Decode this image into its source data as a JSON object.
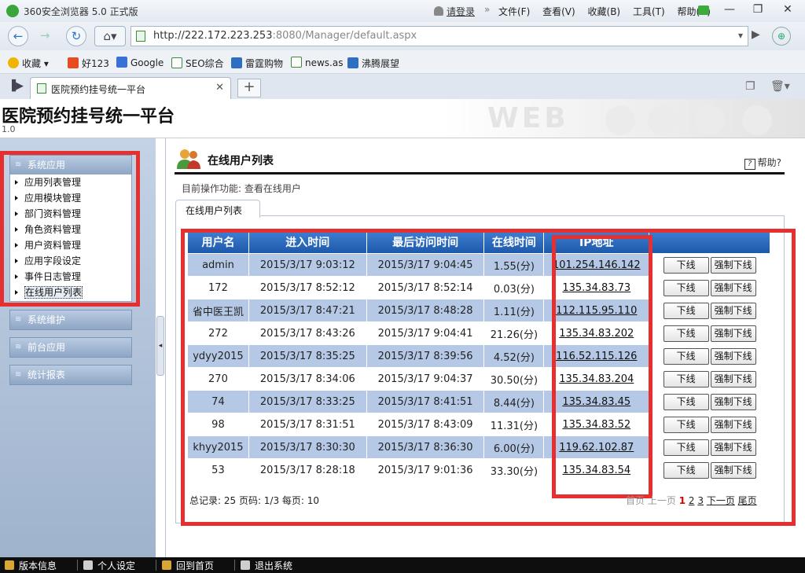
{
  "browser": {
    "title": "360安全浏览器 5.0 正式版",
    "login": "请登录",
    "menus": [
      "文件(F)",
      "查看(V)",
      "收藏(B)",
      "工具(T)",
      "帮助(H)"
    ],
    "url_host": "http://222.172.223.253",
    "url_rest": ":8080/Manager/default.aspx",
    "favorites": [
      "收藏",
      "好123",
      "Google",
      "SEO综合",
      "雷霆购物",
      "news.as",
      "沸腾展望"
    ],
    "tab_title": "医院预约挂号统一平台"
  },
  "app": {
    "title": "医院预约挂号统一平台",
    "version": "1.0",
    "header_deco": "WEB"
  },
  "sidebar": {
    "groups": [
      {
        "label": "系统应用"
      },
      {
        "label": "系统维护"
      },
      {
        "label": "前台应用"
      },
      {
        "label": "统计报表"
      }
    ],
    "items": [
      {
        "label": "应用列表管理"
      },
      {
        "label": "应用模块管理"
      },
      {
        "label": "部门资料管理"
      },
      {
        "label": "角色资料管理"
      },
      {
        "label": "用户资料管理"
      },
      {
        "label": "应用字段设定"
      },
      {
        "label": "事件日志管理"
      },
      {
        "label": "在线用户列表"
      }
    ],
    "selected_item": "在线用户列表"
  },
  "page": {
    "title": "在线用户列表",
    "help": "帮助?",
    "current_op": "目前操作功能: 查看在线用户",
    "tab": "在线用户列表"
  },
  "table": {
    "headers": [
      "用户名",
      "进入时间",
      "最后访问时间",
      "在线时间",
      "IP地址"
    ],
    "rows": [
      {
        "user": "admin",
        "enter": "2015/3/17 9:03:12",
        "last": "2015/3/17 9:04:45",
        "online": "1.55(分)",
        "ip": "101.254.146.142"
      },
      {
        "user": "172",
        "enter": "2015/3/17 8:52:12",
        "last": "2015/3/17 8:52:14",
        "online": "0.03(分)",
        "ip": "135.34.83.73"
      },
      {
        "user": "省中医王凯",
        "enter": "2015/3/17 8:47:21",
        "last": "2015/3/17 8:48:28",
        "online": "1.11(分)",
        "ip": "112.115.95.110"
      },
      {
        "user": "272",
        "enter": "2015/3/17 8:43:26",
        "last": "2015/3/17 9:04:41",
        "online": "21.26(分)",
        "ip": "135.34.83.202"
      },
      {
        "user": "ydyy2015",
        "enter": "2015/3/17 8:35:25",
        "last": "2015/3/17 8:39:56",
        "online": "4.52(分)",
        "ip": "116.52.115.126"
      },
      {
        "user": "270",
        "enter": "2015/3/17 8:34:06",
        "last": "2015/3/17 9:04:37",
        "online": "30.50(分)",
        "ip": "135.34.83.204"
      },
      {
        "user": "74",
        "enter": "2015/3/17 8:33:25",
        "last": "2015/3/17 8:41:51",
        "online": "8.44(分)",
        "ip": "135.34.83.45"
      },
      {
        "user": "98",
        "enter": "2015/3/17 8:31:51",
        "last": "2015/3/17 8:43:09",
        "online": "11.31(分)",
        "ip": "135.34.83.52"
      },
      {
        "user": "khyy2015",
        "enter": "2015/3/17 8:30:30",
        "last": "2015/3/17 8:36:30",
        "online": "6.00(分)",
        "ip": "119.62.102.87"
      },
      {
        "user": "53",
        "enter": "2015/3/17 8:28:18",
        "last": "2015/3/17 9:01:36",
        "online": "33.30(分)",
        "ip": "135.34.83.54"
      }
    ],
    "btn_offline": "下线",
    "btn_force_offline": "强制下线"
  },
  "pager": {
    "summary": "总记录: 25 页码: 1/3 每页: 10",
    "first": "首页",
    "prev": "上一页",
    "pages": [
      "1",
      "2",
      "3"
    ],
    "current_page": "1",
    "next": "下一页",
    "last": "尾页"
  },
  "status_bar": [
    "版本信息",
    "个人设定",
    "回到首页",
    "退出系统"
  ],
  "colors": {
    "highlight_border": "#e63030",
    "table_header": "#2a68bd",
    "row_alt": "#b5c9e6",
    "sidebar_bg": "#aec0d9"
  }
}
